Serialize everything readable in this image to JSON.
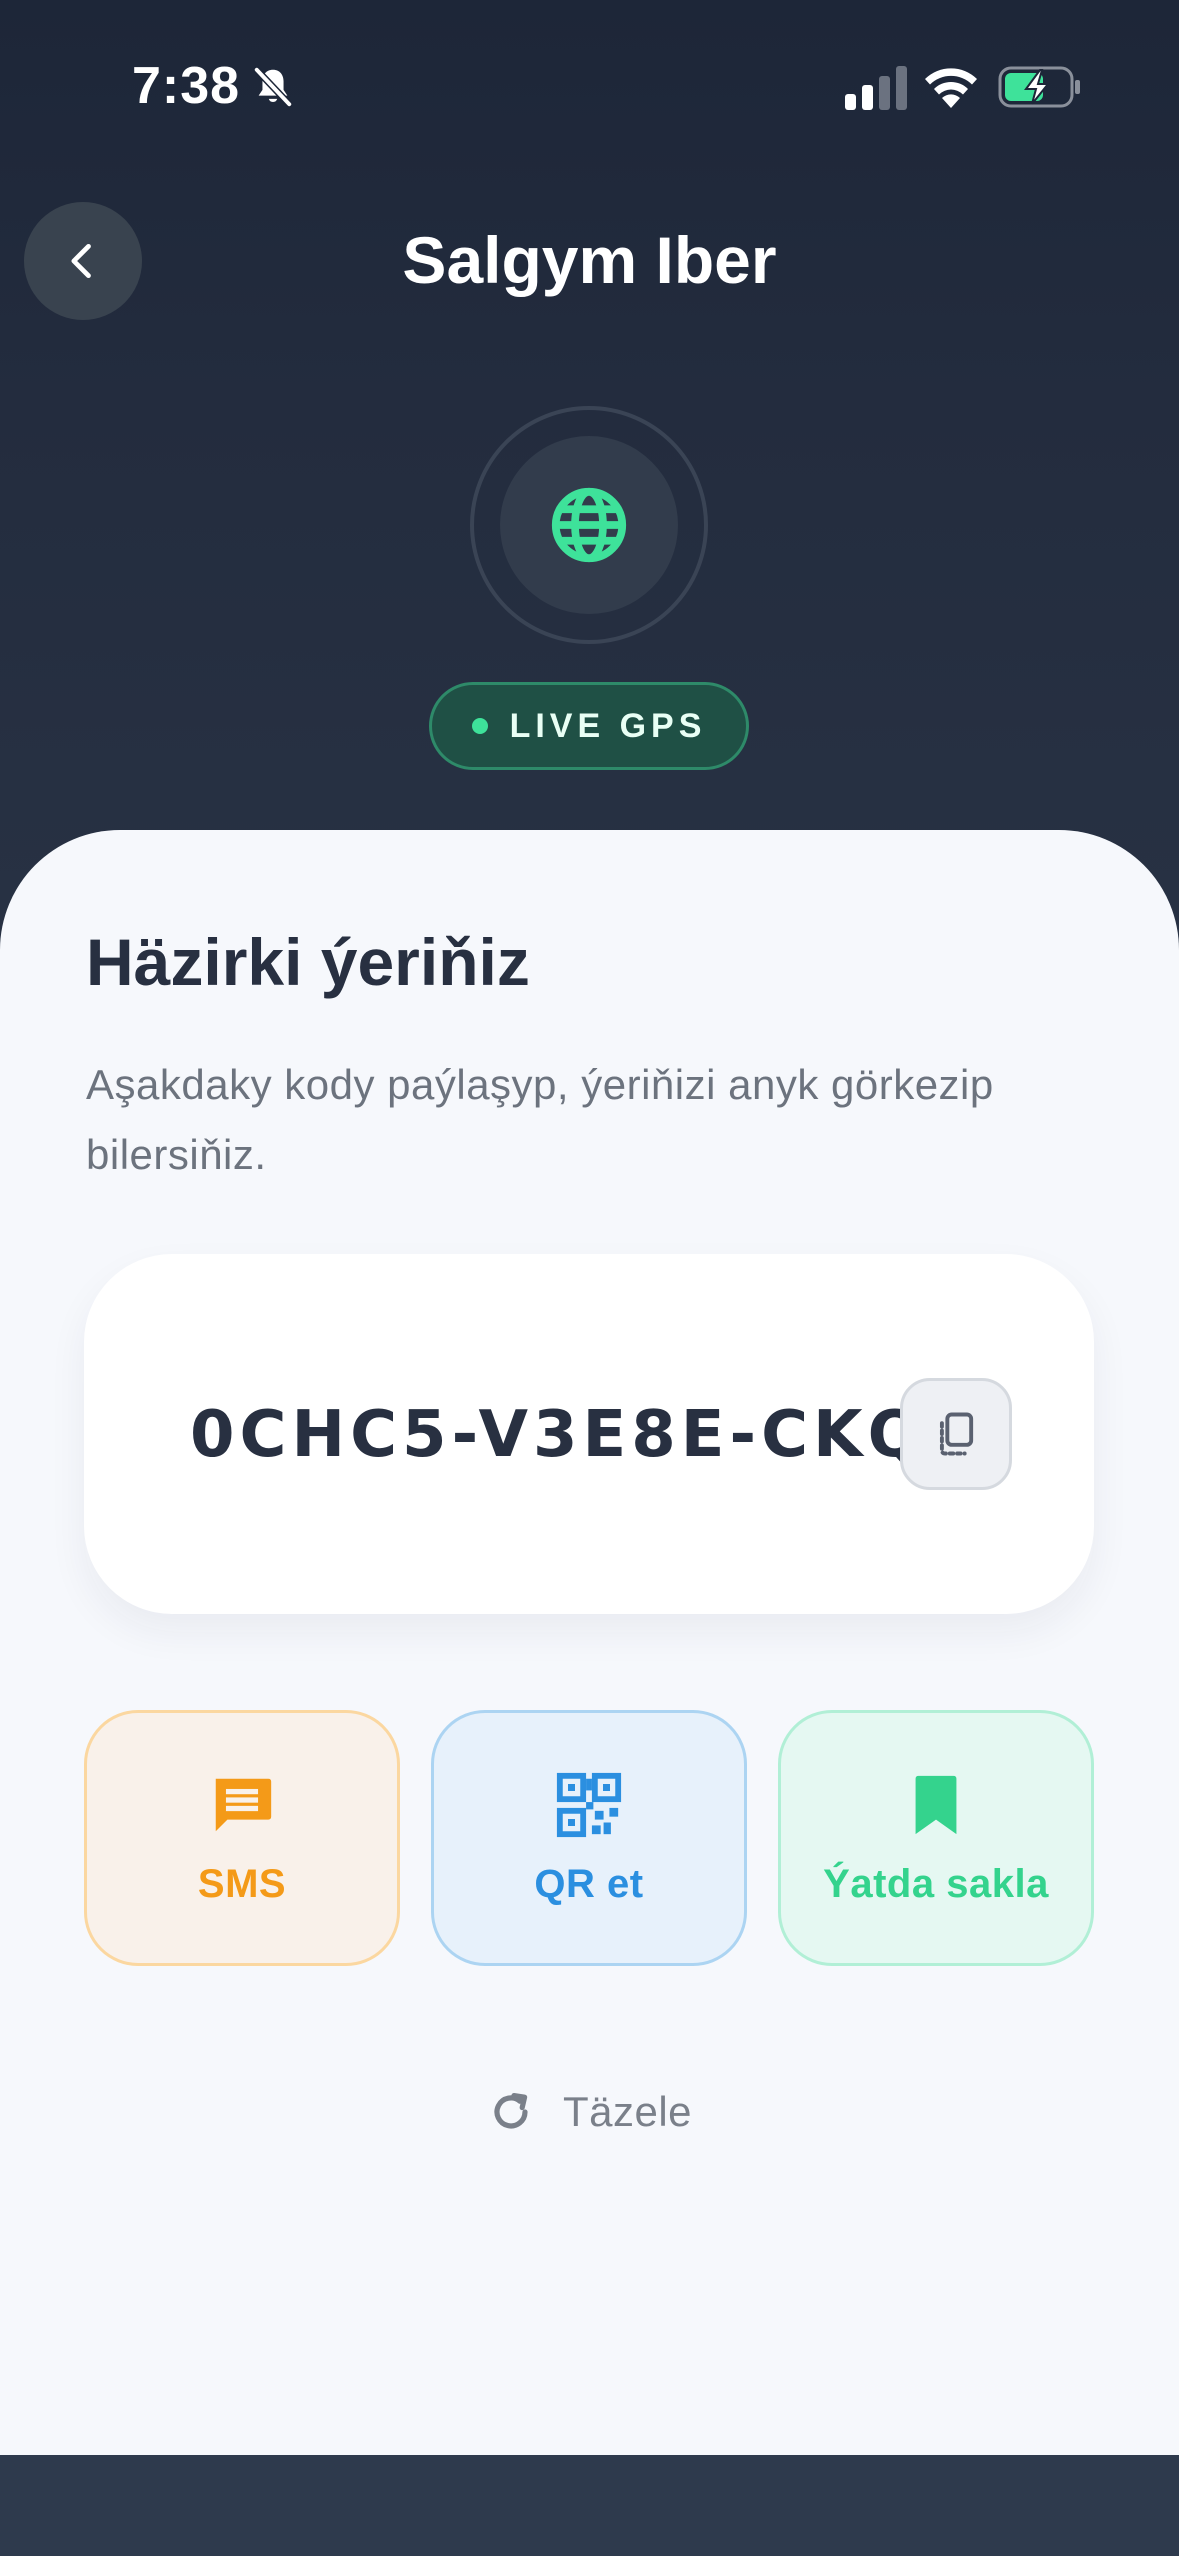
{
  "status_bar": {
    "time": "7:38",
    "icons": [
      "bell-slash-icon",
      "cellular-signal-icon",
      "wifi-icon",
      "battery-charging-icon"
    ]
  },
  "header": {
    "back_icon": "chevron-left-icon",
    "title": "Salgym Iber",
    "hero_icon": "globe-icon",
    "badge_label": "LIVE GPS"
  },
  "location": {
    "title": "Häzirki ýeriňiz",
    "description": "Aşakdaky kody paýlaşyp, ýeriňizi anyk görkezip bilersiňiz.",
    "code": "0CHC5-V3E8E-CKQ",
    "copy_icon": "copy-icon"
  },
  "actions": [
    {
      "label": "SMS",
      "icon": "message-icon",
      "color": "#f49a18"
    },
    {
      "label": "QR et",
      "icon": "qr-code-icon",
      "color": "#2b8fe0"
    },
    {
      "label": "Ýatda sakla",
      "icon": "bookmark-icon",
      "color": "#34d38d"
    }
  ],
  "refresh": {
    "label": "Täzele",
    "icon": "refresh-icon"
  },
  "colors": {
    "header_bg": "#1f2839",
    "sheet_bg": "#f6f8fc",
    "accent_green": "#3ee29a",
    "text_dark": "#283041"
  }
}
